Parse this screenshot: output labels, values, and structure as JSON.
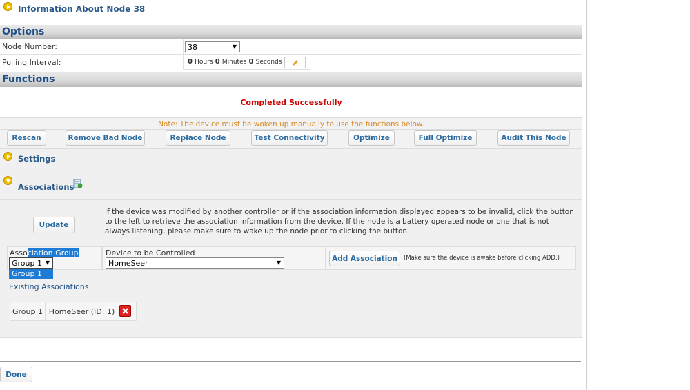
{
  "node_info": {
    "title": "Information About Node 38"
  },
  "options": {
    "heading": "Options",
    "node_number_label": "Node Number:",
    "node_number_value": "38",
    "polling_label": "Polling Interval:",
    "polling": {
      "hours": "0",
      "hours_unit": "Hours",
      "minutes": "0",
      "minutes_unit": "Minutes",
      "seconds": "0",
      "seconds_unit": "Seconds"
    }
  },
  "functions": {
    "heading": "Functions",
    "status": "Completed Successfully",
    "note": "Note: The device must be woken up manually to use the functions below.",
    "buttons": [
      "Rescan",
      "Remove Bad Node",
      "Replace Node",
      "Test Connectivity",
      "Optimize",
      "Full Optimize",
      "Audit This Node"
    ]
  },
  "settings": {
    "title": "Settings"
  },
  "associations": {
    "title": "Associations",
    "update_label": "Update",
    "description": "If the device was modified by another controller or if the association information displayed appears to be invalid, click the button to the left to retrieve the association information from the device. If the node is a battery operated node or one that is not always listening, please make sure to wake up the node prior to clicking the button.",
    "group_label_a": "Asso",
    "group_label_b": "ciation Group",
    "group_value": "Group 1",
    "group_dropdown_item": "Group 1",
    "device_label": "Device to be Controlled",
    "device_value": "HomeSeer",
    "add_label": "Add Association",
    "add_hint": "(Make sure the device is awake before clicking ADD.)",
    "existing_label": "Existing Associations",
    "existing": [
      {
        "group": "Group 1",
        "device": "HomeSeer (ID: 1)"
      }
    ]
  },
  "done_label": "Done",
  "colors": {
    "accent_blue": "#1f4e86",
    "success_red": "#cc0000",
    "note_orange": "#d88a2a",
    "highlight": "#1e7bd6"
  }
}
